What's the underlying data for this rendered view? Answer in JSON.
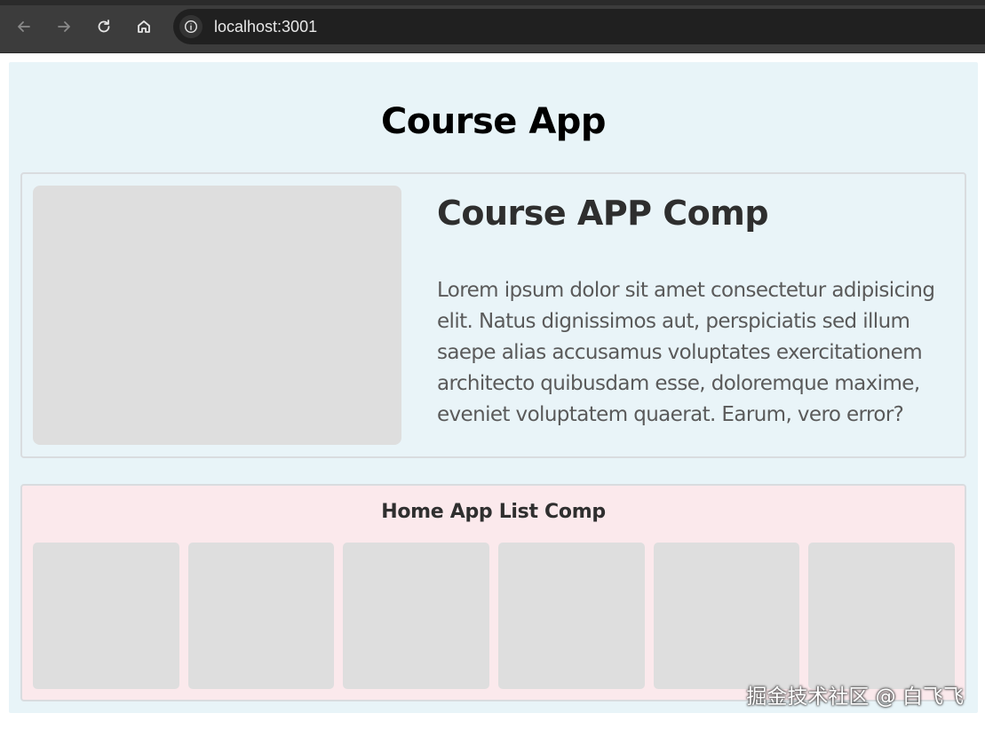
{
  "browser": {
    "url": "localhost:3001",
    "icons": {
      "back": "arrow-left-icon",
      "forward": "arrow-right-icon",
      "reload": "reload-icon",
      "home": "home-icon",
      "info": "info-icon"
    }
  },
  "app": {
    "title": "Course App",
    "hero": {
      "heading": "Course APP Comp",
      "text": "Lorem ipsum dolor sit amet consectetur adipisicing elit. Natus dignissimos aut, perspiciatis sed illum saepe alias accusamus voluptates exercitationem architecto quibusdam esse, doloremque maxime, eveniet voluptatem quaerat. Earum, vero error?"
    },
    "list": {
      "title": "Home App List Comp",
      "item_count": 6
    }
  },
  "watermark": "掘金技术社区 @ 白飞飞",
  "colors": {
    "app_background": "#e8f4f8",
    "list_background": "#fbe9ec",
    "placeholder": "#dedede"
  }
}
